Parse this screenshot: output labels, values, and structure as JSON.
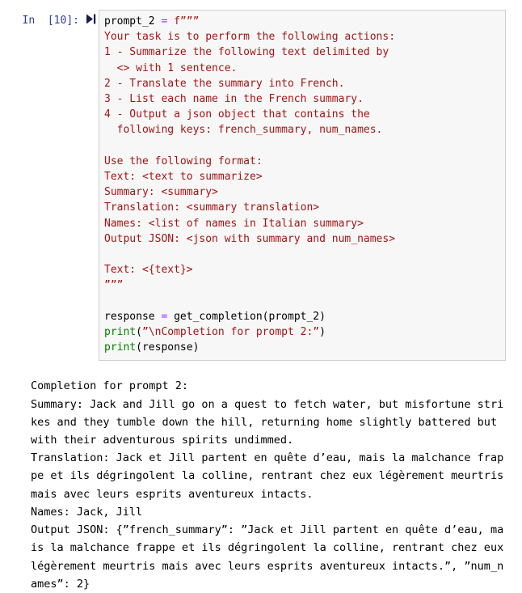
{
  "cell": {
    "prompt_label": "In  [10]:",
    "run_icon_name": "run-cell-icon",
    "execution_count": "10",
    "code_lines": [
      {
        "segments": [
          {
            "t": "prompt_2 ",
            "c": "name"
          },
          {
            "t": "=",
            "c": "op"
          },
          {
            "t": " f”””",
            "c": "str"
          }
        ]
      },
      {
        "segments": [
          {
            "t": "Your task is to perform the following actions: ",
            "c": "str"
          }
        ]
      },
      {
        "segments": [
          {
            "t": "1 - Summarize the following text delimited by ",
            "c": "str"
          }
        ]
      },
      {
        "segments": [
          {
            "t": "  <> with 1 sentence.",
            "c": "str"
          }
        ]
      },
      {
        "segments": [
          {
            "t": "2 - Translate the summary into French.",
            "c": "str"
          }
        ]
      },
      {
        "segments": [
          {
            "t": "3 - List each name in the French summary.",
            "c": "str"
          }
        ]
      },
      {
        "segments": [
          {
            "t": "4 - Output a json object that contains the ",
            "c": "str"
          }
        ]
      },
      {
        "segments": [
          {
            "t": "  following keys: french_summary, num_names.",
            "c": "str"
          }
        ]
      },
      {
        "segments": [
          {
            "t": "",
            "c": "str"
          }
        ]
      },
      {
        "segments": [
          {
            "t": "Use the following format:",
            "c": "str"
          }
        ]
      },
      {
        "segments": [
          {
            "t": "Text: <text to summarize>",
            "c": "str"
          }
        ]
      },
      {
        "segments": [
          {
            "t": "Summary: <summary>",
            "c": "str"
          }
        ]
      },
      {
        "segments": [
          {
            "t": "Translation: <summary translation>",
            "c": "str"
          }
        ]
      },
      {
        "segments": [
          {
            "t": "Names: <list of names in Italian summary>",
            "c": "str"
          }
        ]
      },
      {
        "segments": [
          {
            "t": "Output JSON: <json with summary and num_names>",
            "c": "str"
          }
        ]
      },
      {
        "segments": [
          {
            "t": "",
            "c": "str"
          }
        ]
      },
      {
        "segments": [
          {
            "t": "Text: <{text}>",
            "c": "str"
          }
        ]
      },
      {
        "segments": [
          {
            "t": "”””",
            "c": "str"
          }
        ]
      },
      {
        "segments": [
          {
            "t": "",
            "c": "name"
          }
        ]
      },
      {
        "segments": [
          {
            "t": "response ",
            "c": "name"
          },
          {
            "t": "=",
            "c": "op"
          },
          {
            "t": " get_completion(prompt_2)",
            "c": "name"
          }
        ]
      },
      {
        "segments": [
          {
            "t": "print",
            "c": "bi"
          },
          {
            "t": "(",
            "c": "name"
          },
          {
            "t": "”\\nCompletion for prompt 2:”",
            "c": "str"
          },
          {
            "t": ")",
            "c": "name"
          }
        ]
      },
      {
        "segments": [
          {
            "t": "print",
            "c": "bi"
          },
          {
            "t": "(response)",
            "c": "name"
          }
        ]
      }
    ]
  },
  "output": {
    "lines": [
      "Completion for prompt 2:",
      "Summary: Jack and Jill go on a quest to fetch water, but misfortune stri",
      "kes and they tumble down the hill, returning home slightly battered but",
      "with their adventurous spirits undimmed.",
      "Translation: Jack et Jill partent en quête d’eau, mais la malchance frap",
      "pe et ils dégringolent la colline, rentrant chez eux légèrement meurtris",
      "mais avec leurs esprits aventureux intacts.",
      "Names: Jack, Jill",
      "Output JSON: {”french_summary”: ”Jack et Jill partent en quête d’eau, ma",
      "is la malchance frappe et ils dégringolent la colline, rentrant chez eux",
      "légèrement meurtris mais avec leurs esprits aventureux intacts.”, ”num_n",
      "ames”: 2}"
    ]
  },
  "colors": {
    "prompt": "#303F9F",
    "string": "#A31515",
    "operator": "#AA22FF",
    "builtin": "#008000",
    "cell_bg": "#f7f7f7",
    "cell_border": "#cfcfcf"
  }
}
